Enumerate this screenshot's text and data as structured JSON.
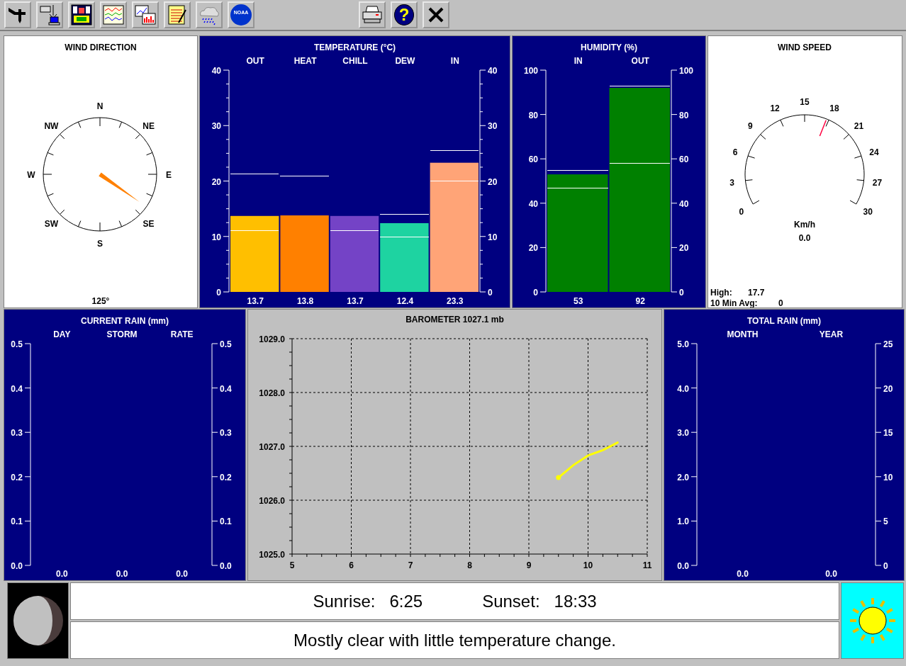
{
  "toolbar": {
    "logo_text": "NOAA",
    "help_glyph": "?"
  },
  "wind_direction": {
    "title": "WIND DIRECTION",
    "points": [
      "N",
      "NE",
      "E",
      "SE",
      "S",
      "SW",
      "W",
      "NW"
    ],
    "reading": "125°"
  },
  "temperature": {
    "chart_data": {
      "type": "bar",
      "title": "TEMPERATURE (°C)",
      "categories": [
        "OUT",
        "HEAT",
        "CHILL",
        "DEW",
        "IN"
      ],
      "series": [
        {
          "colors": [
            "#ffbf00",
            "#ff8000",
            "#7443c6",
            "#1ed3a1",
            "#ffa477"
          ],
          "values": [
            13.7,
            13.8,
            13.7,
            12.4,
            23.3
          ]
        }
      ],
      "ylim": [
        0,
        40
      ],
      "yticks": [
        {
          "value": 0,
          "label": "0"
        },
        {
          "value": 10,
          "label": "10"
        },
        {
          "value": 20,
          "label": "20"
        },
        {
          "value": 30,
          "label": "30"
        },
        {
          "value": 40,
          "label": "40"
        }
      ],
      "value_labels": [
        "13.7",
        "13.8",
        "13.7",
        "12.4",
        "23.3"
      ]
    },
    "right_axis": [
      "40",
      "30",
      "20",
      "10",
      "0"
    ]
  },
  "humidity": {
    "chart_data": {
      "type": "bar",
      "title": "HUMIDITY (%)",
      "categories": [
        "IN",
        "OUT"
      ],
      "series": [
        {
          "color": "#008000",
          "values": [
            53,
            92
          ]
        }
      ],
      "ylim": [
        0,
        100
      ],
      "yticks": [
        {
          "value": 0,
          "label": "0"
        },
        {
          "value": 20,
          "label": "20"
        },
        {
          "value": 40,
          "label": "40"
        },
        {
          "value": 60,
          "label": "60"
        },
        {
          "value": 80,
          "label": "80"
        },
        {
          "value": 100,
          "label": "100"
        }
      ],
      "value_labels": [
        "53",
        "92"
      ]
    },
    "right_axis": [
      "100",
      "80",
      "60",
      "40",
      "20",
      "0"
    ]
  },
  "wind_speed": {
    "title": "WIND SPEED",
    "gauge_labels": [
      "0",
      "3",
      "6",
      "9",
      "12",
      "15",
      "18",
      "21",
      "24",
      "27",
      "30"
    ],
    "unit": "Km/h",
    "reading": "0.0",
    "high_label": "High:",
    "high_value": "17.7",
    "avg_label": "10 Min Avg:",
    "avg_value": "0"
  },
  "current_rain": {
    "chart_data": {
      "type": "bar",
      "title": "CURRENT RAIN (mm)",
      "categories": [
        "DAY",
        "STORM",
        "RATE"
      ],
      "series": [
        {
          "values": [
            0,
            0,
            0
          ]
        }
      ],
      "ylim": [
        0,
        0.5
      ],
      "yticks": [
        {
          "value": 0,
          "label": "0.0"
        },
        {
          "value": 0.1,
          "label": "0.1"
        },
        {
          "value": 0.2,
          "label": "0.2"
        },
        {
          "value": 0.3,
          "label": "0.3"
        },
        {
          "value": 0.4,
          "label": "0.4"
        },
        {
          "value": 0.5,
          "label": "0.5"
        }
      ],
      "value_labels": [
        "0.0",
        "0.0",
        "0.0"
      ]
    },
    "right_axis": [
      "0.5",
      "0.4",
      "0.3",
      "0.2",
      "0.1",
      "0.0"
    ]
  },
  "barometer": {
    "chart_data": {
      "type": "line",
      "title": "BAROMETER 1027.1 mb",
      "x": [
        9.5,
        9.75,
        10.0,
        10.25,
        10.5
      ],
      "series": [
        {
          "color": "#ffff00",
          "values": [
            1026.42,
            1026.65,
            1026.83,
            1026.93,
            1027.07
          ]
        }
      ],
      "xlim": [
        5,
        11
      ],
      "ylim": [
        1025,
        1029
      ],
      "xticks": [
        5,
        6,
        7,
        8,
        9,
        10,
        11
      ],
      "grid": true,
      "yticks": [
        {
          "value": 1025,
          "label": "1025.0"
        },
        {
          "value": 1026,
          "label": "1026.0"
        },
        {
          "value": 1027,
          "label": "1027.0"
        },
        {
          "value": 1028,
          "label": "1028.0"
        },
        {
          "value": 1029,
          "label": "1029.0"
        }
      ]
    }
  },
  "total_rain": {
    "chart_data": {
      "type": "bar",
      "title": "TOTAL RAIN (mm)",
      "categories": [
        "MONTH",
        "YEAR"
      ],
      "series": [
        {
          "values": [
            0,
            0
          ]
        }
      ],
      "ylim": [
        0,
        5
      ],
      "yticks": [
        {
          "value": 0,
          "label": "0.0"
        },
        {
          "value": 1,
          "label": "1.0"
        },
        {
          "value": 2,
          "label": "2.0"
        },
        {
          "value": 3,
          "label": "3.0"
        },
        {
          "value": 4,
          "label": "4.0"
        },
        {
          "value": 5,
          "label": "5.0"
        }
      ],
      "value_labels": [
        "0.0",
        "0.0"
      ]
    },
    "right_axis": [
      "25",
      "20",
      "15",
      "10",
      "5",
      "0"
    ]
  },
  "almanac": {
    "sunrise_label": "Sunrise:",
    "sunrise": "6:25",
    "sunset_label": "Sunset:",
    "sunset": "18:33"
  },
  "forecast": "Mostly clear with little temperature change."
}
